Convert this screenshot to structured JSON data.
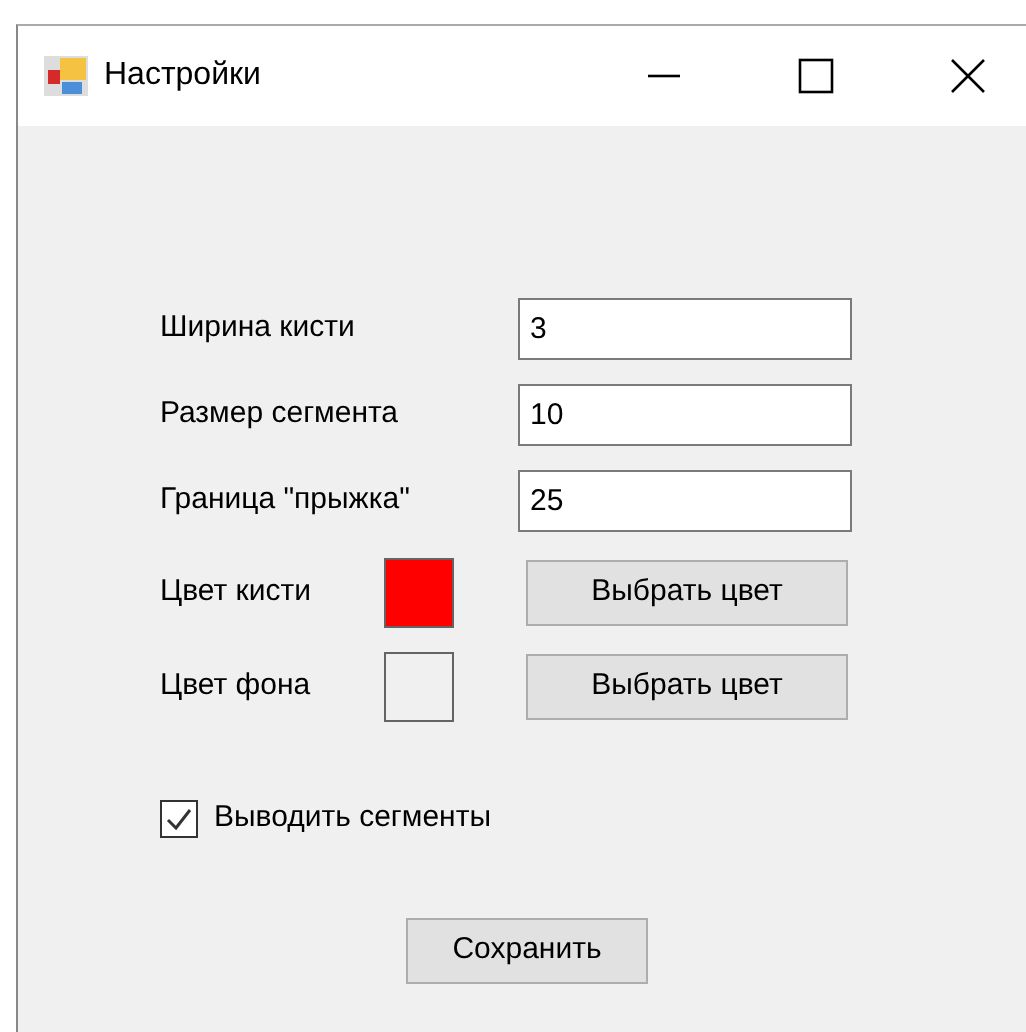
{
  "window": {
    "title": "Настройки"
  },
  "fields": [
    {
      "label": "Ширина кисти",
      "value": "3"
    },
    {
      "label": "Размер сегмента",
      "value": "10"
    },
    {
      "label": "Граница \"прыжка\"",
      "value": "25"
    }
  ],
  "colors": [
    {
      "label": "Цвет кисти",
      "color": "#ff0000",
      "button": "Выбрать цвет"
    },
    {
      "label": "Цвет фона",
      "color": "#f0f0f0",
      "button": "Выбрать цвет"
    }
  ],
  "checkbox": {
    "label": "Выводить сегменты",
    "checked": true
  },
  "save_button": "Сохранить"
}
